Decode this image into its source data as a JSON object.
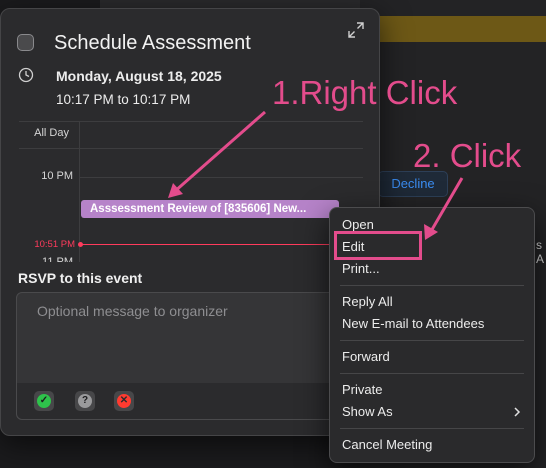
{
  "background": {
    "decline_label": "Decline",
    "edge_text": "s\nA"
  },
  "popup": {
    "title": "Schedule Assessment",
    "date": "Monday, August 18, 2025",
    "time_range": "10:17 PM to 10:17 PM",
    "calendar": {
      "all_day_label": "All Day",
      "ten_pm_label": "10 PM",
      "now_label": "10:51 PM",
      "eleven_pm_label": "11 PM",
      "event_title": "Asssessment Review of [835606] New..."
    },
    "rsvp": {
      "title": "RSVP to this event",
      "message_placeholder": "Optional message to organizer",
      "accept_icon": "check-icon",
      "tentative_icon": "question-icon",
      "decline_icon": "x-icon"
    }
  },
  "context_menu": {
    "items": [
      {
        "label": "Open"
      },
      {
        "label": "Edit"
      },
      {
        "label": "Print..."
      },
      {
        "label": "Reply All"
      },
      {
        "label": "New E-mail to Attendees"
      },
      {
        "label": "Forward"
      },
      {
        "label": "Private"
      },
      {
        "label": "Show As",
        "submenu": true
      },
      {
        "label": "Cancel Meeting"
      }
    ]
  },
  "annotations": {
    "step1": "1.Right Click",
    "step2": "2. Click",
    "color": "#e34c8c"
  },
  "colors": {
    "event_purple": "#b683c9",
    "now_red": "#ff3b5c",
    "accept_green": "#2ec24b",
    "tentative_gray": "#9a9a9c",
    "decline_red": "#ff3b30",
    "link_blue": "#3b8df2"
  }
}
